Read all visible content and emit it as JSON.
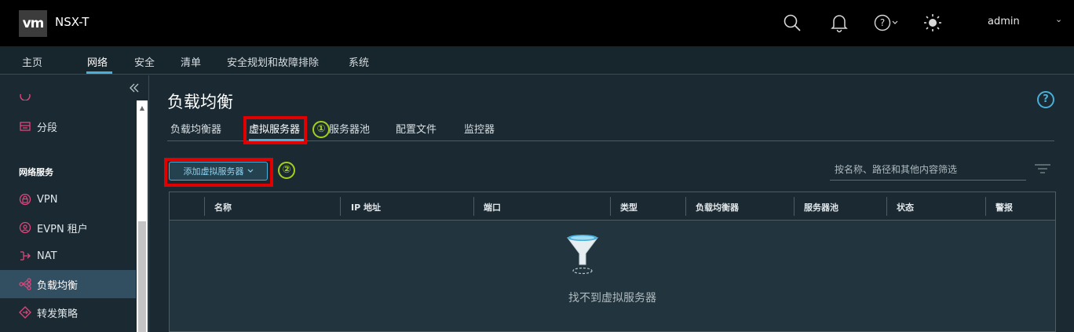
{
  "header": {
    "logo_text": "vm",
    "product": "NSX-T",
    "user": "admin",
    "icons": [
      "search-icon",
      "bell-icon",
      "help-icon",
      "sun-icon"
    ]
  },
  "nav": {
    "items": [
      {
        "label": "主页",
        "active": false
      },
      {
        "label": "网络",
        "active": true
      },
      {
        "label": "安全",
        "active": false
      },
      {
        "label": "清单",
        "active": false
      },
      {
        "label": "安全规划和故障排除",
        "active": false
      },
      {
        "label": "系统",
        "active": false
      }
    ]
  },
  "sidebar": {
    "section_label": "网络服务",
    "items": [
      {
        "label": "分段",
        "icon": "segment-icon",
        "active": false
      },
      {
        "label": "VPN",
        "icon": "vpn-lock-icon",
        "active": false
      },
      {
        "label": "EVPN 租户",
        "icon": "evpn-icon",
        "active": false
      },
      {
        "label": "NAT",
        "icon": "nat-icon",
        "active": false
      },
      {
        "label": "负载均衡",
        "icon": "load-balancer-icon",
        "active": true
      },
      {
        "label": "转发策略",
        "icon": "forwarding-icon",
        "active": false
      }
    ]
  },
  "page": {
    "title": "负载均衡",
    "tabs": [
      {
        "label": "负载均衡器",
        "active": false
      },
      {
        "label": "虚拟服务器",
        "active": true
      },
      {
        "label": "服务器池",
        "active": false
      },
      {
        "label": "配置文件",
        "active": false
      },
      {
        "label": "监控器",
        "active": false
      }
    ],
    "add_button_label": "添加虚拟服务器",
    "filter_placeholder": "按名称、路径和其他内容筛选",
    "columns": [
      "名称",
      "IP 地址",
      "端口",
      "类型",
      "负载均衡器",
      "服务器池",
      "状态",
      "警报"
    ],
    "empty_message": "找不到虚拟服务器"
  },
  "annotations": {
    "marker_1": "①",
    "marker_2": "②",
    "highlight_color": "#e00000",
    "marker_color": "#a4cf1a"
  },
  "colors": {
    "accent": "#49afd9",
    "topbar": "#000000",
    "background": "#1b2a32"
  }
}
